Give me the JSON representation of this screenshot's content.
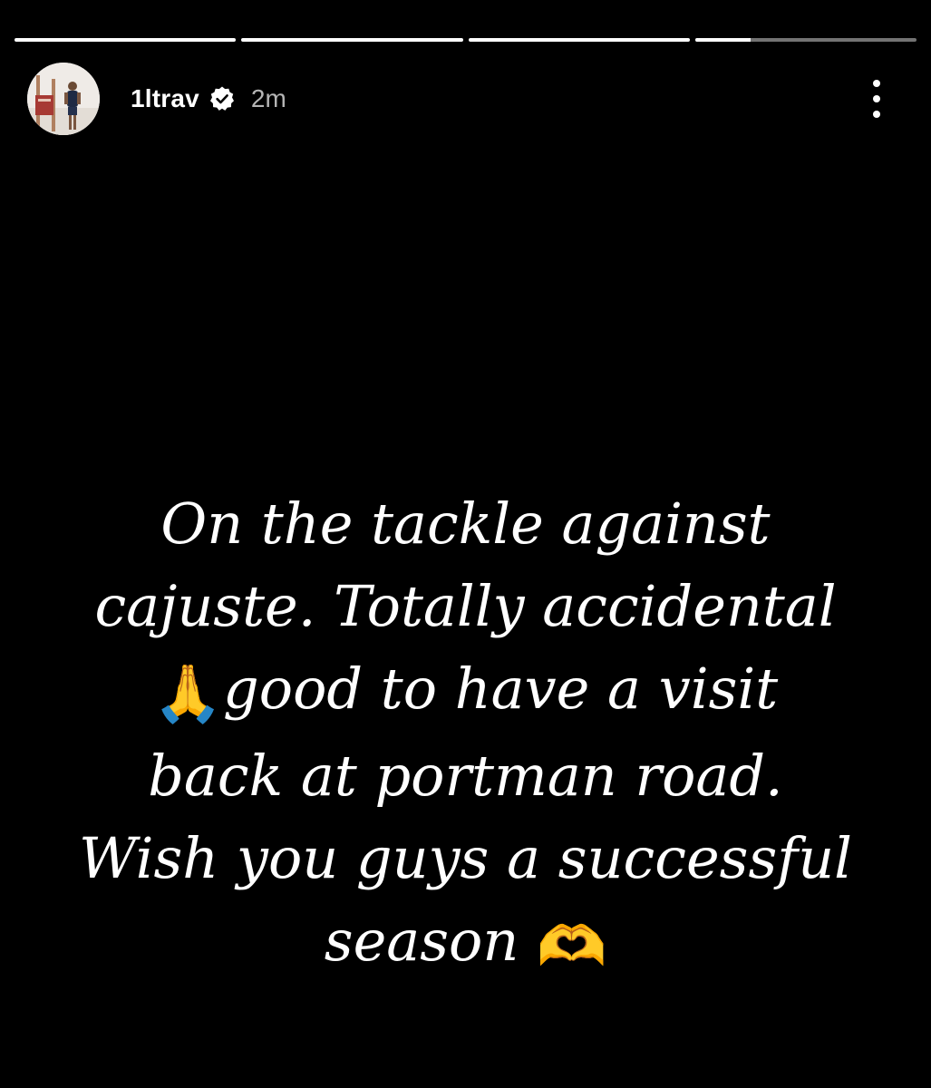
{
  "story": {
    "progress": [
      1,
      1,
      1,
      0.25
    ],
    "user": {
      "username": "1ltrav",
      "time_ago": "2m",
      "verified": true,
      "avatar_icon": "avatar-photo"
    },
    "caption_lines": [
      "On the tackle against",
      "cajuste. Totally accidental",
      "good to have a visit",
      "back at portman road.",
      "Wish you guys a successful",
      "season"
    ],
    "emojis": {
      "pray": "🙏",
      "heart_hands": "🫶"
    }
  },
  "colors": {
    "background": "#000000",
    "text": "#ffffff",
    "muted": "#b5b5b5"
  }
}
